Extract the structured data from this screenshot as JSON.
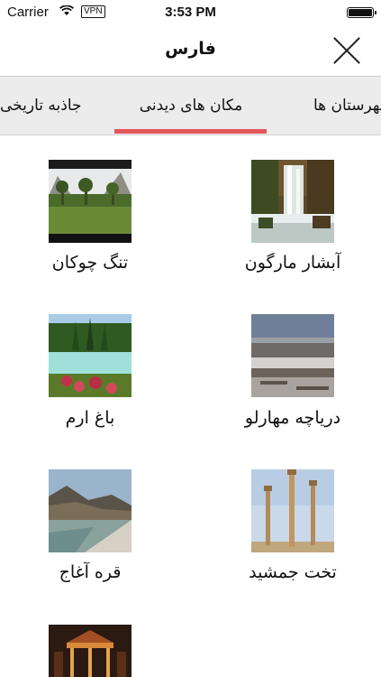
{
  "status_bar": {
    "carrier": "Carrier",
    "vpn": "VPN",
    "time": "3:53 PM"
  },
  "nav": {
    "title": "فارس"
  },
  "tabs": [
    "جاذبه تاریخی",
    "مکان های دیدنی",
    "شهرستان ها"
  ],
  "active_tab": 1,
  "places": [
    {
      "name": "آبشار مارگون",
      "image": "waterfall-photo"
    },
    {
      "name": "تنگ چوکان",
      "image": "valley-palms-photo"
    },
    {
      "name": "دریاچه مهارلو",
      "image": "salt-lake-photo"
    },
    {
      "name": "باغ ارم",
      "image": "garden-photo"
    },
    {
      "name": "تخت جمشید",
      "image": "persepolis-columns-photo"
    },
    {
      "name": "قره آغاج",
      "image": "river-photo"
    },
    {
      "name": "",
      "image": "tomb-pavilion-photo"
    }
  ],
  "colors": {
    "accent": "#e35659",
    "tab_bg": "#ececec"
  }
}
